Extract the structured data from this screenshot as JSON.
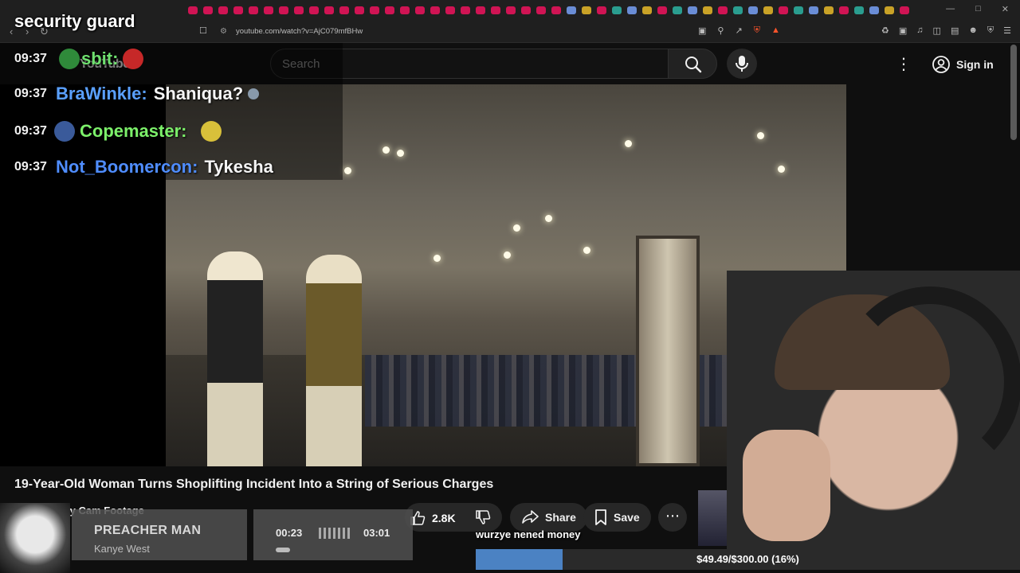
{
  "browser": {
    "url": "youtube.com/watch?v=AjC079mfBHw"
  },
  "youtube": {
    "logo_text": "YouTube",
    "search_placeholder": "Search",
    "signin_label": "Sign in"
  },
  "chat": {
    "header": "security guard",
    "messages": [
      {
        "time": "09:37",
        "user": "sbit:",
        "user_color": "#6fe06f",
        "message": ""
      },
      {
        "time": "09:37",
        "user": "BraWinkle:",
        "user_color": "#5aa0ff",
        "message": "Shaniqua?"
      },
      {
        "time": "09:37",
        "user": "Copemaster:",
        "user_color": "#7cf06a",
        "message": ""
      },
      {
        "time": "09:37",
        "user": "Not_Boomercon:",
        "user_color": "#4f8dff",
        "message": "Tykesha"
      }
    ]
  },
  "video": {
    "title": "19-Year-Old Woman Turns Shoplifting Incident Into a String of Serious Charges",
    "channel": "Duty Cam Footage",
    "likes": "2.8K",
    "share_label": "Share",
    "save_label": "Save"
  },
  "stream_overlay": {
    "song_title": "PREACHER MAN",
    "song_artist": "Kanye West",
    "elapsed": "00:23",
    "duration": "03:01",
    "goal_text": "wurzye nened money",
    "goal_amount": "$49.49/$300.00 (16%)",
    "goal_fraction": 0.16,
    "goal_color": "#4b82c3"
  },
  "colors": {
    "background": "#0f0f0f",
    "pill": "#272727"
  }
}
